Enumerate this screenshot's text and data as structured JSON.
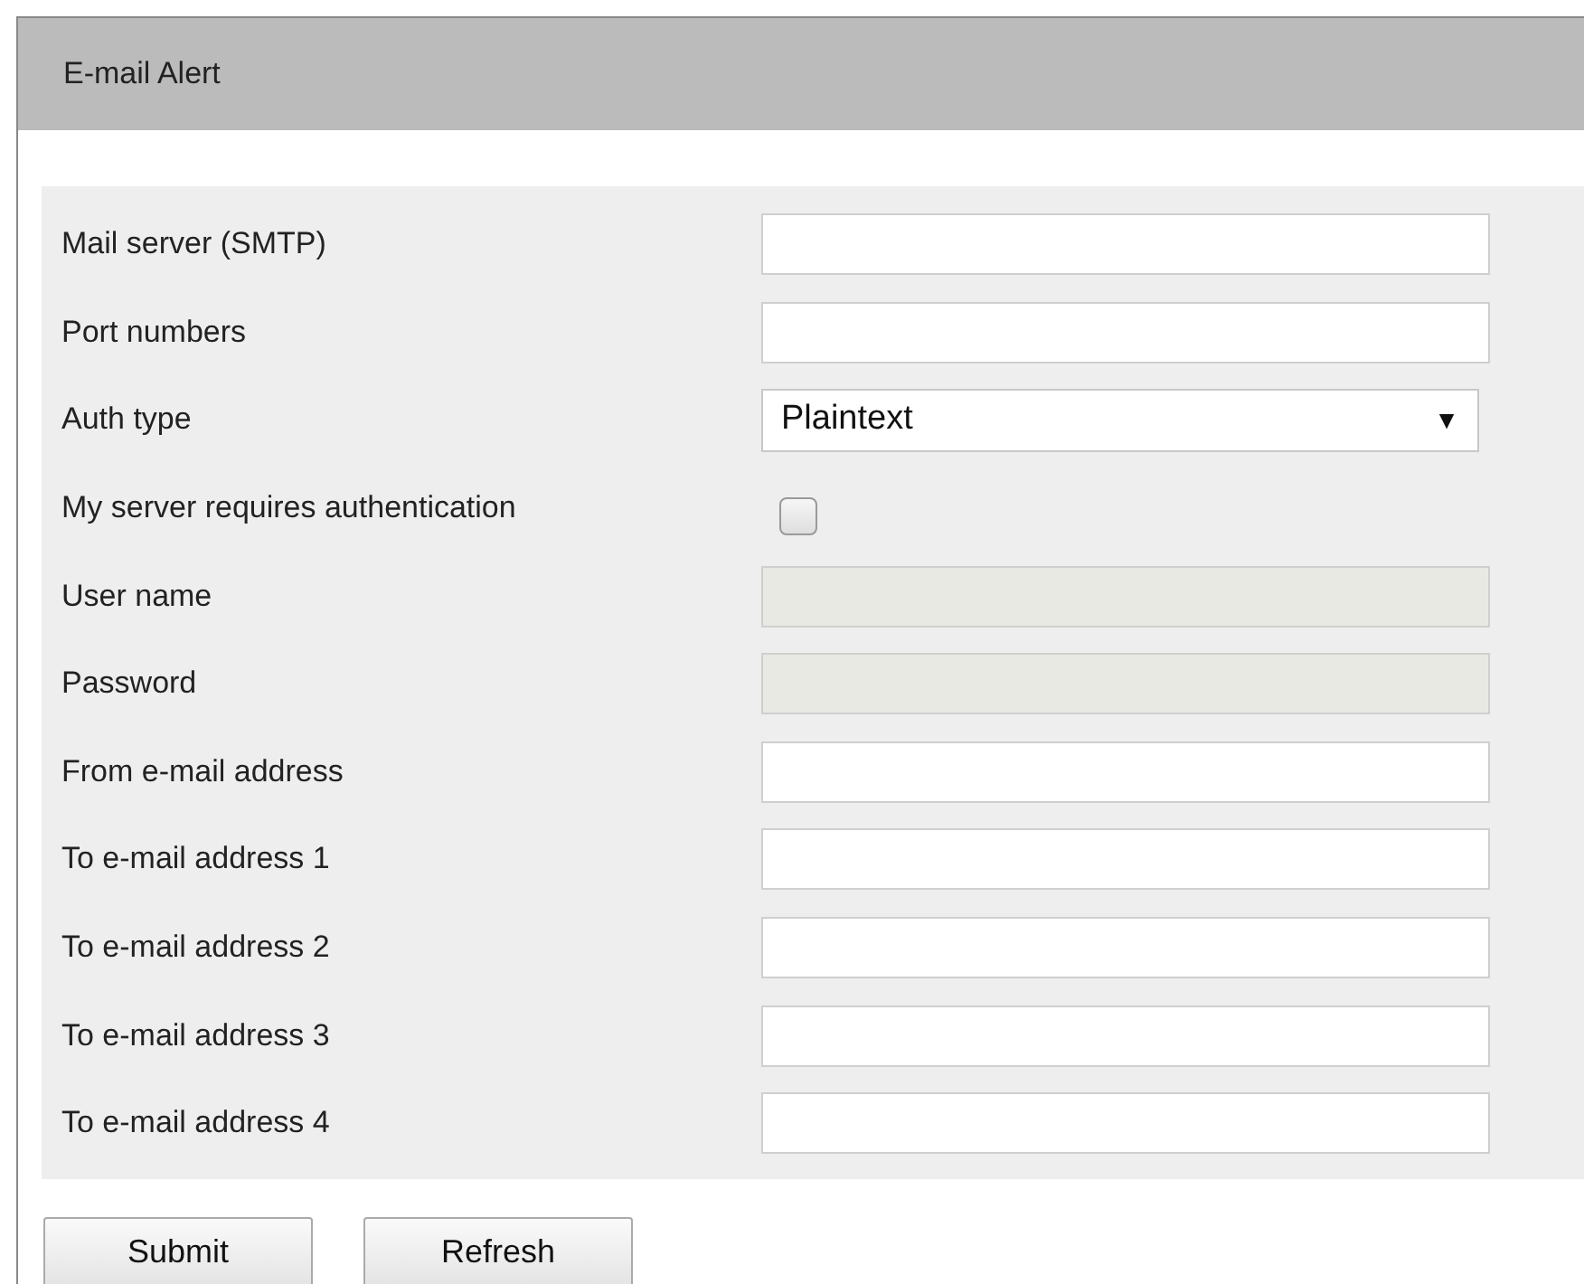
{
  "panel": {
    "title": "E-mail Alert"
  },
  "fields": [
    {
      "kind": "text",
      "label": "Mail server (SMTP)",
      "disabled": false
    },
    {
      "kind": "text",
      "label": "Port numbers",
      "disabled": false
    },
    {
      "kind": "select",
      "label": "Auth type",
      "value": "Plaintext",
      "arrow": "▼"
    },
    {
      "kind": "checkbox",
      "label": "My server requires authentication",
      "checked": false
    },
    {
      "kind": "text",
      "label": "User name",
      "disabled": true
    },
    {
      "kind": "text",
      "label": "Password",
      "disabled": true
    },
    {
      "kind": "text",
      "label": "From e-mail address",
      "disabled": false
    },
    {
      "kind": "text",
      "label": "To e-mail address 1",
      "disabled": false
    },
    {
      "kind": "text",
      "label": "To e-mail address 2",
      "disabled": false
    },
    {
      "kind": "text",
      "label": "To e-mail address 3",
      "disabled": false
    },
    {
      "kind": "text",
      "label": "To e-mail address 4",
      "disabled": false
    }
  ],
  "buttons": [
    "Submit",
    "Refresh"
  ]
}
